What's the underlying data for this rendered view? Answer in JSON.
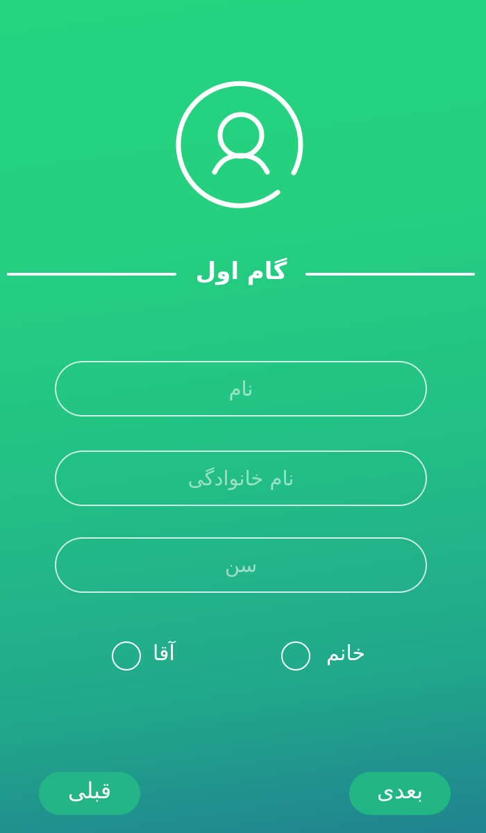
{
  "step": {
    "title": "گام اول"
  },
  "form": {
    "first_name_placeholder": "نام",
    "last_name_placeholder": "نام خانوادگی",
    "age_placeholder": "سن"
  },
  "gender": {
    "male_label": "آقا",
    "female_label": "خانم"
  },
  "nav": {
    "prev_label": "قبلی",
    "next_label": "بعدی"
  },
  "icons": {
    "avatar": "user-circle-icon"
  },
  "colors": {
    "background_top": "#24d47f",
    "background_bottom": "#20838f",
    "button_bg": "#23b685",
    "foreground": "#ffffff"
  }
}
